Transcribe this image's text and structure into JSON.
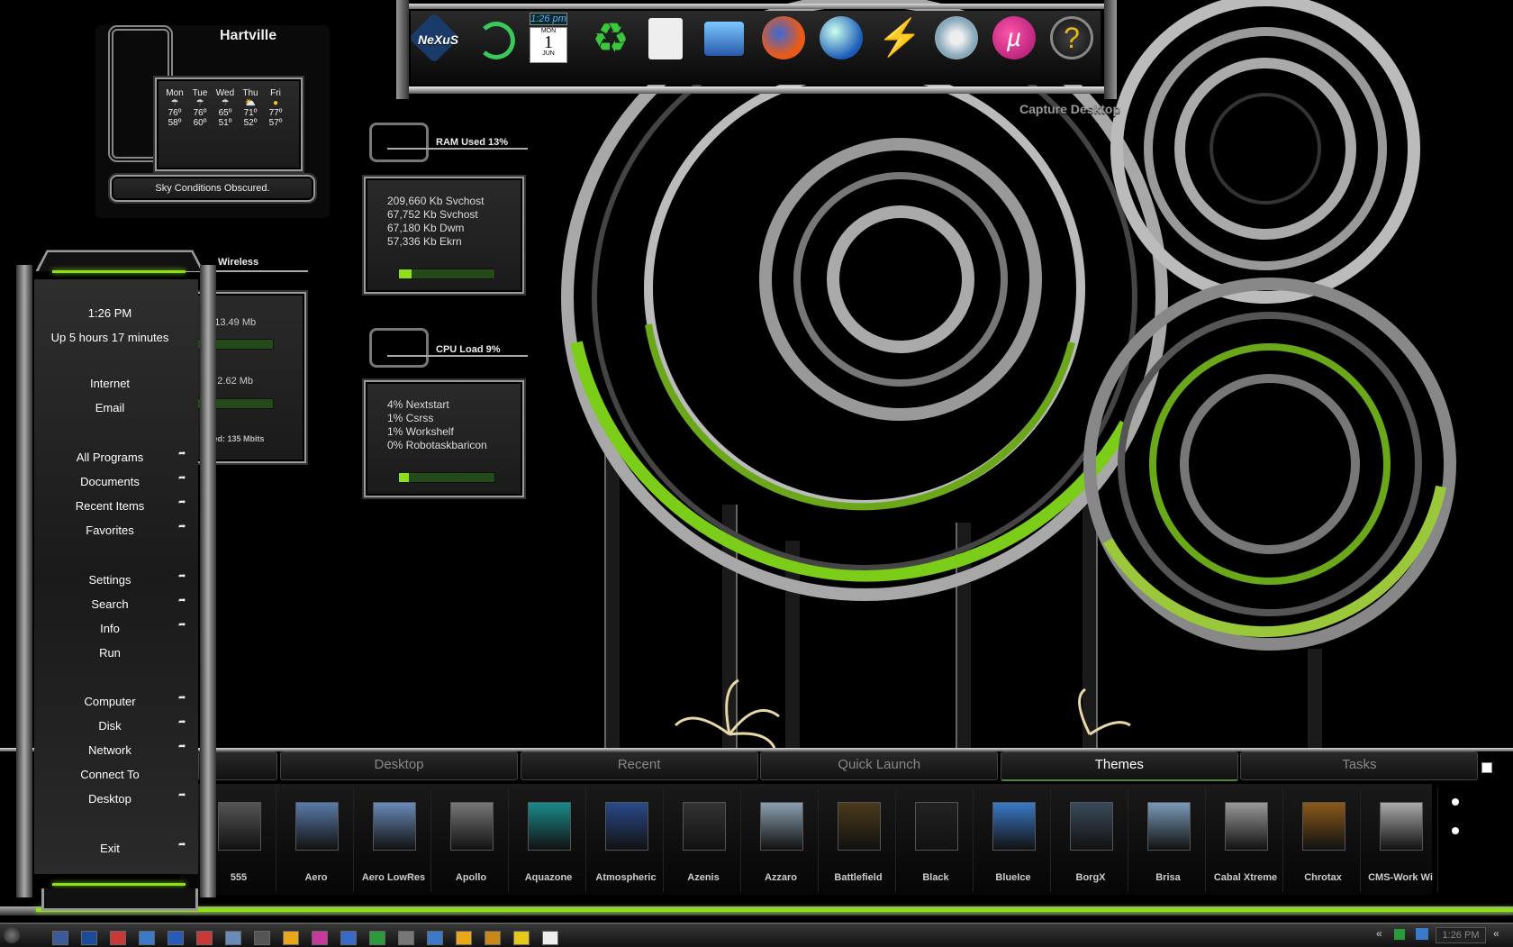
{
  "weather": {
    "city": "Hartville",
    "days": [
      {
        "day": "Mon",
        "icon": "rain-icon",
        "high": "76º",
        "low": "58º"
      },
      {
        "day": "Tue",
        "icon": "rain-icon",
        "high": "76º",
        "low": "60º"
      },
      {
        "day": "Wed",
        "icon": "rain-icon",
        "high": "65º",
        "low": "51º"
      },
      {
        "day": "Thu",
        "icon": "partly-sunny-icon",
        "high": "71º",
        "low": "52º"
      },
      {
        "day": "Fri",
        "icon": "sun-icon",
        "high": "77º",
        "low": "57º"
      }
    ],
    "conditions": "Sky Conditions Obscured."
  },
  "dock": {
    "clock": "1:26 pm",
    "calendar": {
      "weekday": "MON",
      "day": "1",
      "month": "JUN"
    },
    "icons": [
      "nexus-logo-icon",
      "d-arrow-icon",
      "calendar-icon",
      "recycle-bin-icon",
      "leaf-document-icon",
      "computer-icon",
      "firefox-icon",
      "globe-icon",
      "winamp-icon",
      "itunes-icon",
      "utorrent-icon",
      "help-icon"
    ],
    "nexus_label": "NeXuS"
  },
  "capture_desktop": "Capture Desktop",
  "ram": {
    "title": "RAM Used 13%",
    "usage": 0.13,
    "processes": [
      "209,660 Kb Svchost",
      "67,752 Kb Svchost",
      "67,180 Kb Dwm",
      "57,336 Kb Ekrn"
    ]
  },
  "cpu": {
    "title": "CPU Load 9%",
    "usage": 0.09,
    "processes": [
      "4% Nextstart",
      "1% Csrss",
      "1% Workshelf",
      "0% Robotaskbaricon"
    ]
  },
  "wireless": {
    "title": "Wireless",
    "in": "n: 13.49 Mb",
    "out": "ut: 2.62 Mb",
    "speed": "peed: 135 Mbits"
  },
  "start_menu": {
    "time": "1:26 PM",
    "uptime": "Up 5 hours 17 minutes",
    "items": [
      {
        "label": "Internet",
        "arrow": false
      },
      {
        "label": "Email",
        "arrow": false
      },
      {
        "label": "All Programs",
        "arrow": true
      },
      {
        "label": "Documents",
        "arrow": true
      },
      {
        "label": "Recent Items",
        "arrow": true
      },
      {
        "label": "Favorites",
        "arrow": true
      },
      {
        "label": "Settings",
        "arrow": true
      },
      {
        "label": "Search",
        "arrow": true
      },
      {
        "label": "Info",
        "arrow": true
      },
      {
        "label": "Run",
        "arrow": false
      },
      {
        "label": "Computer",
        "arrow": true
      },
      {
        "label": "Disk",
        "arrow": true
      },
      {
        "label": "Network",
        "arrow": true
      },
      {
        "label": "Connect To",
        "arrow": false
      },
      {
        "label": "Desktop",
        "arrow": true
      },
      {
        "label": "Exit",
        "arrow": true
      }
    ],
    "arrow_glyph": "➦"
  },
  "shelf": {
    "tabs": [
      "Desktop",
      "Recent",
      "Quick Launch",
      "Themes",
      "Tasks"
    ],
    "active_tab": "Themes",
    "themes": [
      {
        "name": "555",
        "color": "#555"
      },
      {
        "name": "Aero",
        "color": "#5a7aa8"
      },
      {
        "name": "Aero LowRes",
        "color": "#6a8ab8"
      },
      {
        "name": "Apollo",
        "color": "#777"
      },
      {
        "name": "Aquazone",
        "color": "#1a8a8a"
      },
      {
        "name": "Atmospheric",
        "color": "#2a4a8a"
      },
      {
        "name": "Azenis",
        "color": "#333"
      },
      {
        "name": "Azzaro",
        "color": "#8aa0b0"
      },
      {
        "name": "Battlefield",
        "color": "#4a3a1a"
      },
      {
        "name": "Black",
        "color": "#222"
      },
      {
        "name": "BlueIce",
        "color": "#3a7ac8"
      },
      {
        "name": "BorgX",
        "color": "#3a4a5a"
      },
      {
        "name": "Brisa",
        "color": "#7a9ab8"
      },
      {
        "name": "Cabal Xtreme",
        "color": "#999"
      },
      {
        "name": "Chrotax",
        "color": "#8a5a1a"
      },
      {
        "name": "CMS-Work Wi",
        "color": "#aaa"
      }
    ]
  },
  "taskbar": {
    "clock": "1:26 PM"
  },
  "colors": {
    "accent": "#8ee01a",
    "chrome": "#9a9a9a"
  }
}
